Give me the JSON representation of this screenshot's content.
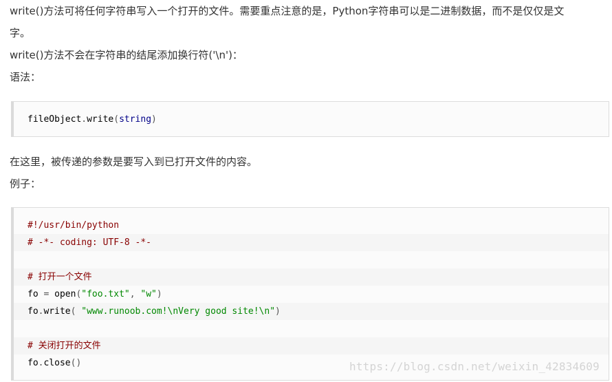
{
  "paragraphs": {
    "p1_line1": "write()方法可将任何字符串写入一个打开的文件。需要重点注意的是，Python字符串可以是二进制数据，而不是仅仅是文",
    "p1_line2": "字。",
    "p2": "write()方法不会在字符串的结尾添加换行符('\\n')：",
    "syntax_label": "语法：",
    "p3": "在这里，被传递的参数是要写入到已打开文件的内容。",
    "example_label": "例子："
  },
  "syntax_code": {
    "obj": "fileObject",
    "dot": ".",
    "method": "write",
    "open_paren": "(",
    "arg": "string",
    "close_paren": ")"
  },
  "example_code": {
    "line1": "#!/usr/bin/python",
    "line2": "# -*- coding: UTF-8 -*-",
    "line3": "",
    "line4": "# 打开一个文件",
    "line5_a": "fo",
    "line5_b": " = ",
    "line5_c": "open",
    "line5_d": "(",
    "line5_e": "\"foo.txt\"",
    "line5_f": ", ",
    "line5_g": "\"w\"",
    "line5_h": ")",
    "line6_a": "fo",
    "line6_b": ".",
    "line6_c": "write",
    "line6_d": "( ",
    "line6_e": "\"www.runoob.com!\\nVery good site!\\n\"",
    "line6_f": ")",
    "line7": "",
    "line8": "# 关闭打开的文件",
    "line9_a": "fo",
    "line9_b": ".",
    "line9_c": "close",
    "line9_d": "()"
  },
  "watermark": "https://blog.csdn.net/weixin_42834609"
}
